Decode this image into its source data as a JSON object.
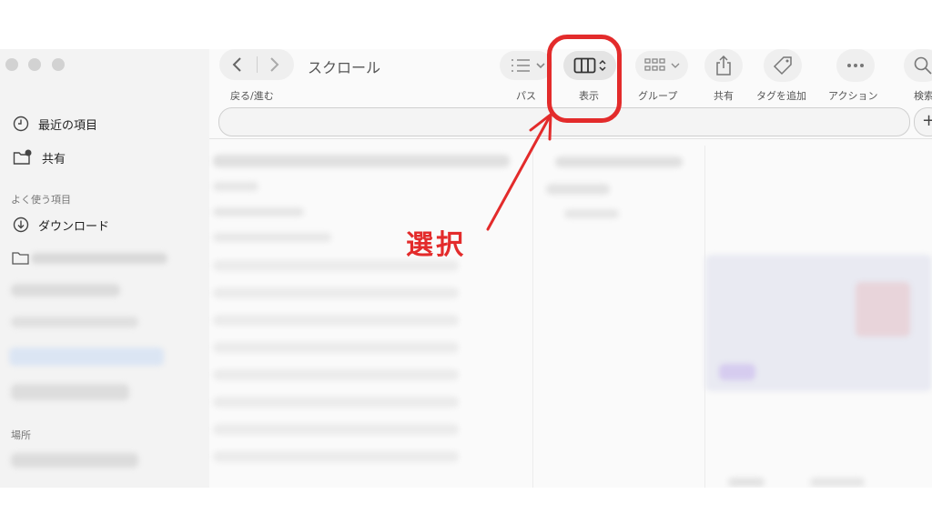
{
  "toolbar": {
    "title": "スクロール",
    "nav_label": "戻る/進む",
    "path_label": "パス",
    "view_label": "表示",
    "group_label": "グループ",
    "share_label": "共有",
    "tag_label": "タグを追加",
    "action_label": "アクション",
    "search_label": "検索"
  },
  "sidebar": {
    "recent": "最近の項目",
    "shared": "共有",
    "favorites_header": "よく使う項目",
    "downloads": "ダウンロード",
    "locations_header": "場所"
  },
  "annotation": {
    "text": "選択",
    "color": "#e32b2b"
  }
}
